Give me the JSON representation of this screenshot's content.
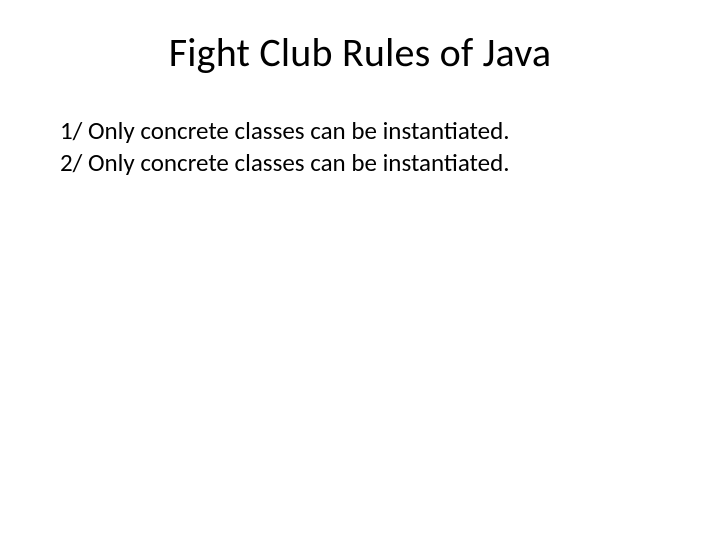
{
  "slide": {
    "title": "Fight Club Rules of Java",
    "rules": [
      "1/ Only concrete classes can be instantiated.",
      "2/ Only concrete classes can be instantiated."
    ]
  }
}
